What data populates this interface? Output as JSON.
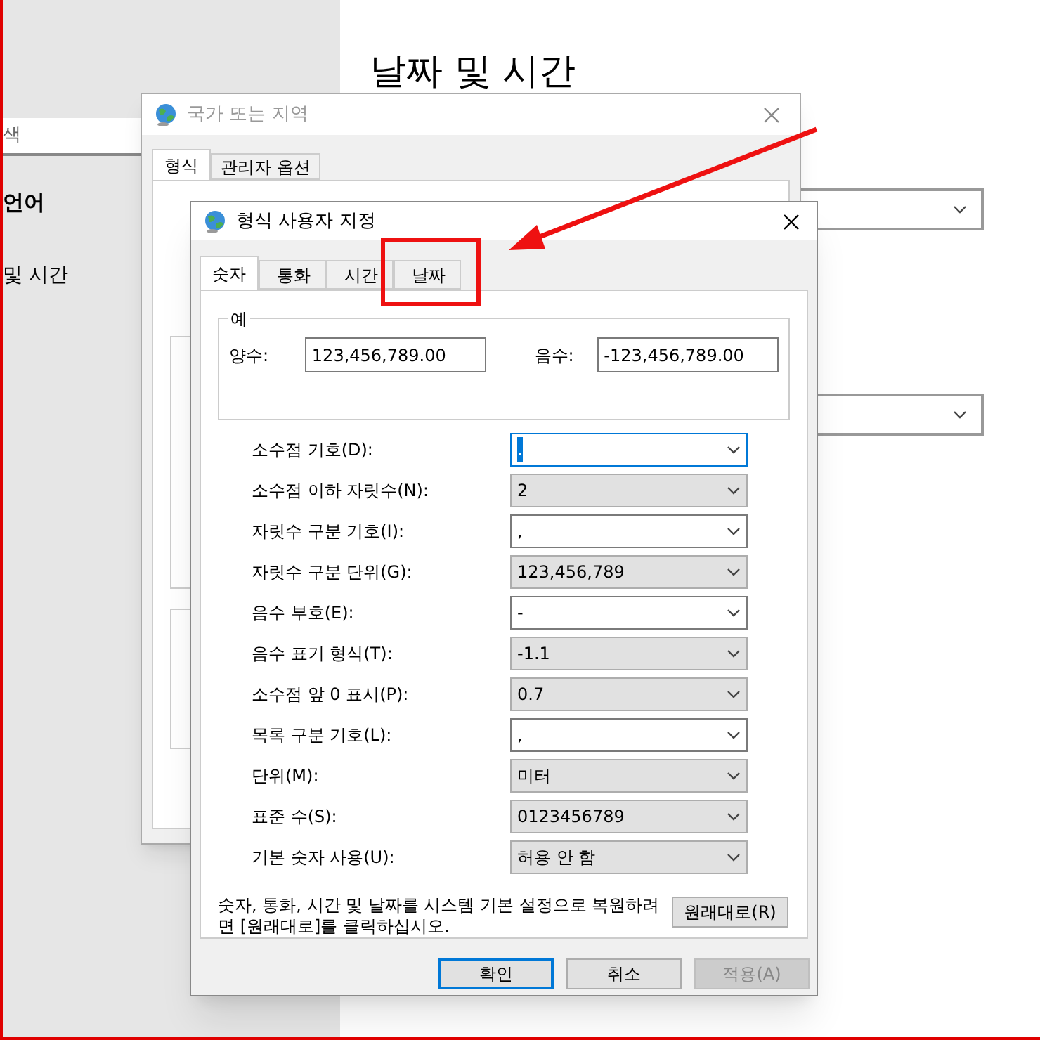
{
  "settings": {
    "search": {
      "placeholder": "색"
    },
    "heading": "언어",
    "items": [
      {
        "label": "및 시간"
      }
    ],
    "title": "날짜 및 시간"
  },
  "region_window": {
    "title": "국가 또는 지역",
    "tabs": [
      {
        "label": "형식",
        "selected": true
      },
      {
        "label": "관리자 옵션",
        "selected": false
      }
    ]
  },
  "customize_dialog": {
    "title": "형식 사용자 지정",
    "tabs": [
      {
        "label": "숫자",
        "selected": true
      },
      {
        "label": "통화",
        "selected": false
      },
      {
        "label": "시간",
        "selected": false
      },
      {
        "label": "날짜",
        "selected": false
      }
    ],
    "example": {
      "label": "예",
      "positive": {
        "label": "양수:",
        "value": "123,456,789.00"
      },
      "negative": {
        "label": "음수:",
        "value": "-123,456,789.00"
      }
    },
    "fields": [
      {
        "label": "소수점 기호(D):",
        "value": ".",
        "kind": "editable",
        "focused": true
      },
      {
        "label": "소수점 이하 자릿수(N):",
        "value": "2",
        "kind": "list",
        "focused": false
      },
      {
        "label": "자릿수 구분 기호(I):",
        "value": ",",
        "kind": "editable",
        "focused": false
      },
      {
        "label": "자릿수 구분 단위(G):",
        "value": "123,456,789",
        "kind": "list",
        "focused": false
      },
      {
        "label": "음수 부호(E):",
        "value": "-",
        "kind": "editable",
        "focused": false
      },
      {
        "label": "음수 표기 형식(T):",
        "value": "-1.1",
        "kind": "list",
        "focused": false
      },
      {
        "label": "소수점 앞 0 표시(P):",
        "value": "0.7",
        "kind": "list",
        "focused": false
      },
      {
        "label": "목록 구분 기호(L):",
        "value": ",",
        "kind": "editable",
        "focused": false
      },
      {
        "label": "단위(M):",
        "value": "미터",
        "kind": "list",
        "focused": false
      },
      {
        "label": "표준 수(S):",
        "value": "0123456789",
        "kind": "list",
        "focused": false
      },
      {
        "label": "기본 숫자 사용(U):",
        "value": "허용 안 함",
        "kind": "list",
        "focused": false
      }
    ],
    "reset_note": "숫자, 통화, 시간 및 날짜를 시스템 기본 설정으로 복원하려면 [원래대로]를 클릭하십시오.",
    "reset_button": "원래대로(R)",
    "buttons": [
      {
        "label": "확인",
        "default": true,
        "disabled": false
      },
      {
        "label": "취소",
        "default": false,
        "disabled": false
      },
      {
        "label": "적용(A)",
        "default": false,
        "disabled": true
      }
    ]
  }
}
